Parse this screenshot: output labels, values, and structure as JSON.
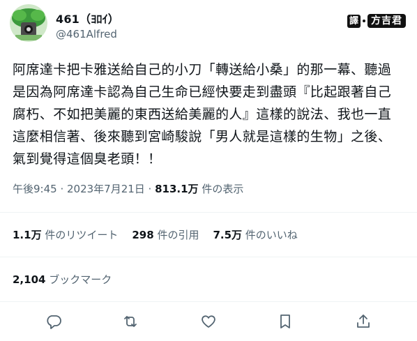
{
  "author": {
    "display_name": "461（ﾖﾛｲ）",
    "handle": "@461Alfred",
    "avatar_icon": "avatar-icon"
  },
  "watermark": {
    "box_char": "譯",
    "text": "方吉君"
  },
  "tweet": {
    "text": "阿席達卡把卡雅送給自己的小刀「轉送給小桑」的那一幕、聽過\n是因為阿席達卡認為自己生命已經快要走到盡頭『比起跟著自己\n腐朽、不如把美麗的東西送給美麗的人』這樣的說法、我也一直\n這麼相信著、後來聽到宮崎駿說「男人就是這樣的生物」之後、\n氣到覺得這個臭老頭！！"
  },
  "meta": {
    "time": "午後9:45 · 2023年7月21日 · ",
    "views_count": "813.1万",
    "views_label": " 件の表示"
  },
  "stats": {
    "retweets_count": "1.1万",
    "retweets_label": " 件のリツイート",
    "quotes_count": "298",
    "quotes_label": " 件の引用",
    "likes_count": "7.5万",
    "likes_label": " 件のいいね"
  },
  "bookmarks": {
    "count": "2,104",
    "label": " ブックマーク"
  },
  "actions": {
    "reply": "reply-icon",
    "retweet": "retweet-icon",
    "like": "heart-icon",
    "bookmark": "bookmark-icon",
    "share": "share-icon"
  },
  "colors": {
    "text": "#0f1419",
    "secondary": "#536471",
    "divider": "#eff3f4"
  }
}
